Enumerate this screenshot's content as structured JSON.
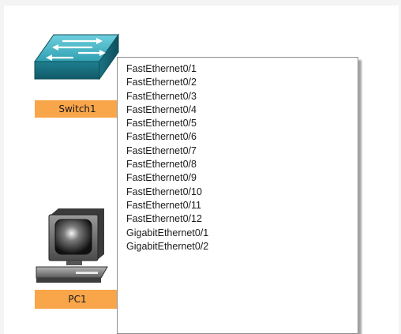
{
  "devices": {
    "switch": {
      "label": "Switch1",
      "icon": "network-switch-icon"
    },
    "pc": {
      "label": "PC1",
      "icon": "desktop-pc-icon"
    }
  },
  "port_menu": {
    "items": [
      {
        "label": "FastEthernet0/1"
      },
      {
        "label": "FastEthernet0/2"
      },
      {
        "label": "FastEthernet0/3"
      },
      {
        "label": "FastEthernet0/4"
      },
      {
        "label": "FastEthernet0/5"
      },
      {
        "label": "FastEthernet0/6"
      },
      {
        "label": "FastEthernet0/7"
      },
      {
        "label": "FastEthernet0/8"
      },
      {
        "label": "FastEthernet0/9"
      },
      {
        "label": "FastEthernet0/10"
      },
      {
        "label": "FastEthernet0/11"
      },
      {
        "label": "FastEthernet0/12"
      },
      {
        "label": "GigabitEthernet0/1"
      },
      {
        "label": "GigabitEthernet0/2"
      }
    ]
  },
  "colors": {
    "label_background": "#f9a54a",
    "switch_teal": "#2e9cae"
  }
}
